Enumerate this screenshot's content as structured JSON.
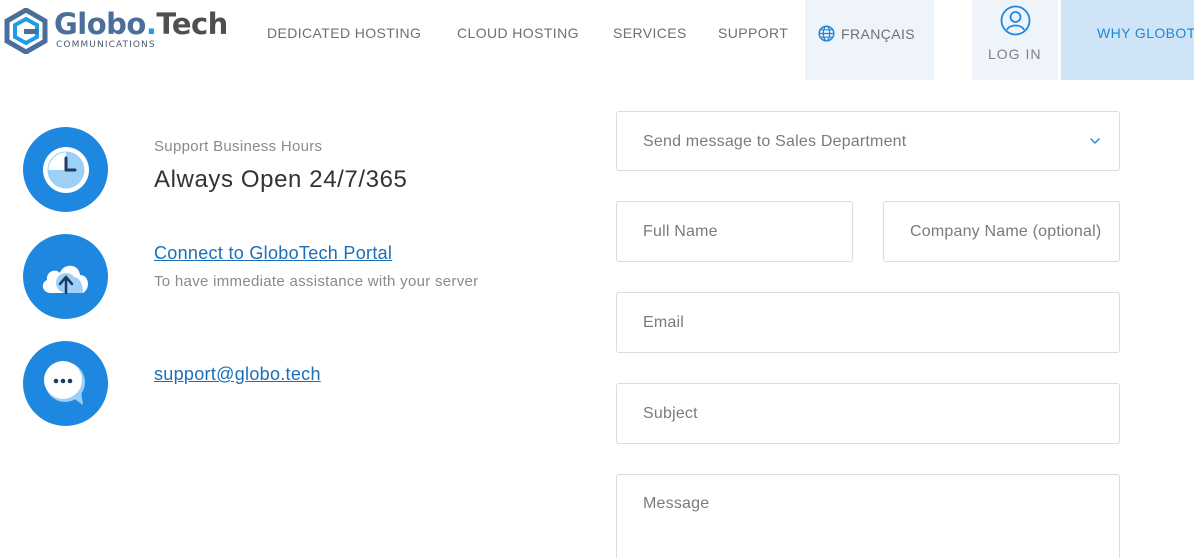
{
  "logo": {
    "name_part1": "Globo",
    "name_dot": ".",
    "name_part2": "Tech",
    "subtitle": "COMMUNICATIONS"
  },
  "nav": {
    "items": [
      {
        "label": "DEDICATED HOSTING"
      },
      {
        "label": "CLOUD HOSTING"
      },
      {
        "label": "SERVICES"
      },
      {
        "label": "SUPPORT"
      }
    ],
    "language": "FRANÇAIS",
    "login": "LOG IN",
    "why": "WHY GLOBOT"
  },
  "info": {
    "hours_label": "Support Business Hours",
    "hours_value": "Always Open 24/7/365",
    "portal_link": "Connect to GloboTech Portal",
    "portal_desc": "To have immediate assistance with your server",
    "email_link": "support@globo.tech"
  },
  "form": {
    "department_select": "Send message to Sales Department",
    "full_name_placeholder": "Full Name",
    "company_placeholder": "Company Name (optional)",
    "email_placeholder": "Email",
    "subject_placeholder": "Subject",
    "message_placeholder": "Message"
  },
  "colors": {
    "brand_blue": "#1e88e0",
    "link_blue": "#1a6fb8",
    "nav_highlight": "#cfe4f7"
  }
}
